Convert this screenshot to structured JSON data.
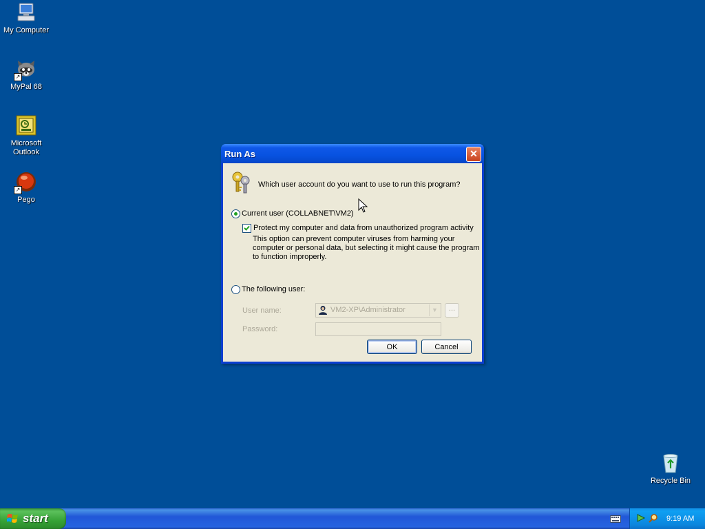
{
  "desktop": {
    "icons": [
      {
        "label": "My Computer"
      },
      {
        "label": "MyPal 68"
      },
      {
        "label": "Microsoft Outlook"
      },
      {
        "label": "Pego"
      },
      {
        "label": "Recycle Bin"
      }
    ]
  },
  "dialog": {
    "title": "Run As",
    "close_label": "✕",
    "question": "Which user account do you want to use to run this program?",
    "current_user_label": "Current user (COLLABNET\\VM2)",
    "current_user_selected": true,
    "protect_label": "Protect my computer and data from unauthorized program activity",
    "protect_checked": true,
    "description": "This option can prevent computer viruses from harming your computer or personal data, but selecting it might cause the program to function improperly.",
    "following_user_label": "The following user:",
    "user_name_label": "User name:",
    "user_name_value": "VM2-XP\\Administrator",
    "browse_label": "...",
    "password_label": "Password:",
    "password_value": "",
    "ok_label": "OK",
    "cancel_label": "Cancel"
  },
  "taskbar": {
    "start_label": "start",
    "clock": "9:19 AM"
  },
  "colors": {
    "desktop": "#004e98",
    "titlebar": "#0752e0",
    "dialog_bg": "#ece9d8",
    "start_green": "#36a236"
  }
}
